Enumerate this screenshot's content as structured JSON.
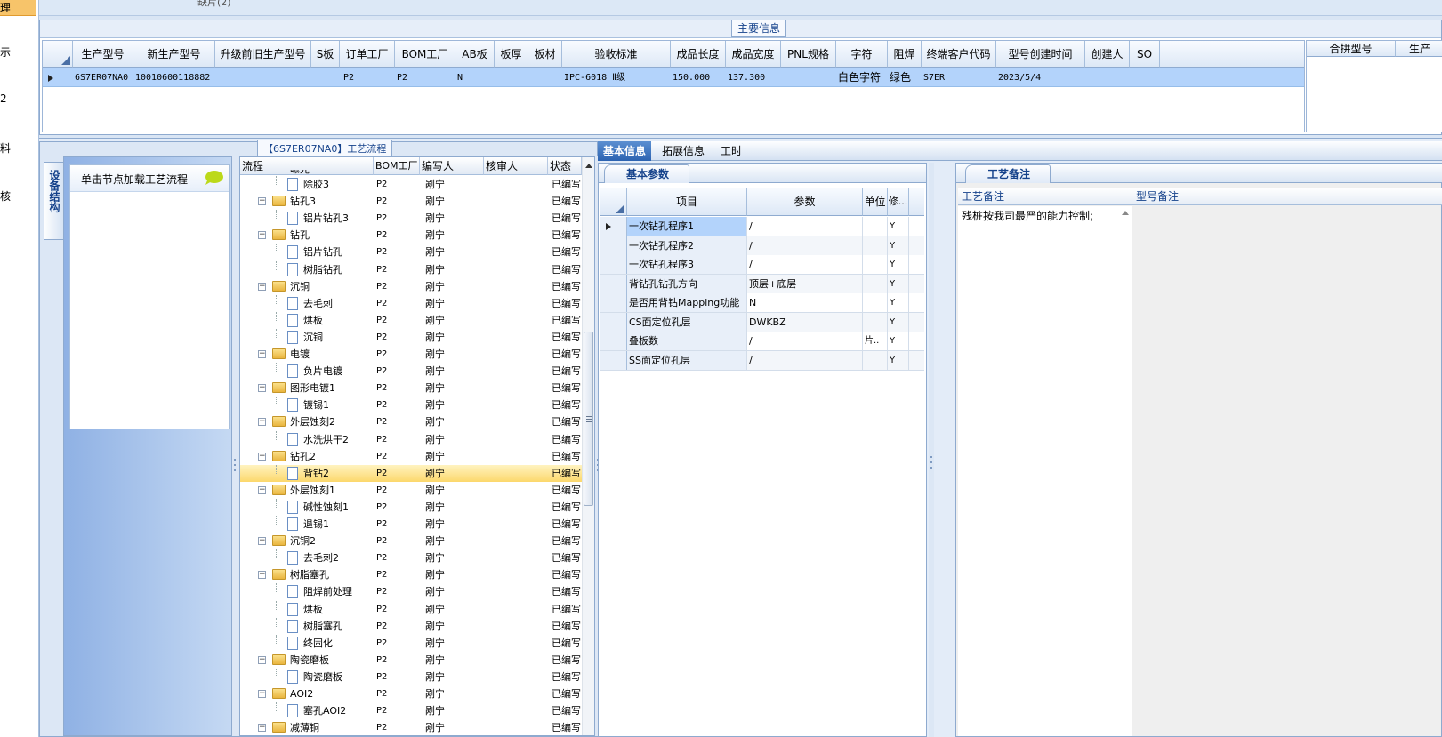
{
  "left_nav": {
    "items": [
      "理",
      "示",
      "2",
      "料",
      "核"
    ]
  },
  "top_fragment": "缺片(2)",
  "main_info": {
    "title": "主要信息",
    "columns": [
      "生产型号",
      "新生产型号",
      "升级前旧生产型号",
      "S板",
      "订单工厂",
      "BOM工厂",
      "AB板",
      "板厚",
      "板材",
      "验收标准",
      "成品长度",
      "成品宽度",
      "PNL规格",
      "字符",
      "阻焊",
      "终端客户代码",
      "型号创建时间",
      "创建人",
      "SO"
    ],
    "row": {
      "model": "6S7ER07NA0",
      "new_model": "10010600118882",
      "old_model": "",
      "s_board": "",
      "order_factory": "P2",
      "bom_factory": "P2",
      "ab_board": "N",
      "thickness": "",
      "material": "",
      "standard": "IPC-6018 Ⅱ级",
      "length": "150.000",
      "width": "137.300",
      "pnl": "",
      "char": "白色字符",
      "mask": "绿色",
      "customer_code": "S7ER",
      "created_time": "2023/5/4",
      "creator": "",
      "so": ""
    },
    "side_columns": [
      "合拼型号",
      "生产"
    ]
  },
  "process": {
    "title": "【6S7ER07NA0】工艺流程",
    "side_tab": "设备结构",
    "equip_hint": "单击节点加载工艺流程",
    "columns": [
      "流程",
      "BOM工厂",
      "编写人",
      "核审人",
      "状态"
    ],
    "partial_top_label": "曝光",
    "rows": [
      {
        "name": "除胶3",
        "level": 2,
        "bom": "P2",
        "writer": "剐宁",
        "status": "已编写"
      },
      {
        "name": "钻孔3",
        "level": 1,
        "bom": "P2",
        "writer": "剐宁",
        "status": "已编写"
      },
      {
        "name": "铝片钻孔3",
        "level": 2,
        "bom": "P2",
        "writer": "剐宁",
        "status": "已编写"
      },
      {
        "name": "钻孔",
        "level": 1,
        "bom": "P2",
        "writer": "剐宁",
        "status": "已编写"
      },
      {
        "name": "铝片钻孔",
        "level": 2,
        "bom": "P2",
        "writer": "剐宁",
        "status": "已编写"
      },
      {
        "name": "树脂钻孔",
        "level": 2,
        "bom": "P2",
        "writer": "剐宁",
        "status": "已编写"
      },
      {
        "name": "沉铜",
        "level": 1,
        "bom": "P2",
        "writer": "剐宁",
        "status": "已编写"
      },
      {
        "name": "去毛刺",
        "level": 2,
        "bom": "P2",
        "writer": "剐宁",
        "status": "已编写"
      },
      {
        "name": "烘板",
        "level": 2,
        "bom": "P2",
        "writer": "剐宁",
        "status": "已编写"
      },
      {
        "name": "沉铜",
        "level": 2,
        "bom": "P2",
        "writer": "剐宁",
        "status": "已编写"
      },
      {
        "name": "电镀",
        "level": 1,
        "bom": "P2",
        "writer": "剐宁",
        "status": "已编写"
      },
      {
        "name": "负片电镀",
        "level": 2,
        "bom": "P2",
        "writer": "剐宁",
        "status": "已编写"
      },
      {
        "name": "图形电镀1",
        "level": 1,
        "bom": "P2",
        "writer": "剐宁",
        "status": "已编写"
      },
      {
        "name": "镀锡1",
        "level": 2,
        "bom": "P2",
        "writer": "剐宁",
        "status": "已编写"
      },
      {
        "name": "外层蚀刻2",
        "level": 1,
        "bom": "P2",
        "writer": "剐宁",
        "status": "已编写"
      },
      {
        "name": "水洗烘干2",
        "level": 2,
        "bom": "P2",
        "writer": "剐宁",
        "status": "已编写"
      },
      {
        "name": "钻孔2",
        "level": 1,
        "bom": "P2",
        "writer": "剐宁",
        "status": "已编写"
      },
      {
        "name": "背钻2",
        "level": 2,
        "bom": "P2",
        "writer": "剐宁",
        "status": "已编写",
        "selected": true
      },
      {
        "name": "外层蚀刻1",
        "level": 1,
        "bom": "P2",
        "writer": "剐宁",
        "status": "已编写"
      },
      {
        "name": "碱性蚀刻1",
        "level": 2,
        "bom": "P2",
        "writer": "剐宁",
        "status": "已编写"
      },
      {
        "name": "退锡1",
        "level": 2,
        "bom": "P2",
        "writer": "剐宁",
        "status": "已编写"
      },
      {
        "name": "沉铜2",
        "level": 1,
        "bom": "P2",
        "writer": "剐宁",
        "status": "已编写"
      },
      {
        "name": "去毛刺2",
        "level": 2,
        "bom": "P2",
        "writer": "剐宁",
        "status": "已编写"
      },
      {
        "name": "树脂塞孔",
        "level": 1,
        "bom": "P2",
        "writer": "剐宁",
        "status": "已编写"
      },
      {
        "name": "阻焊前处理",
        "level": 2,
        "bom": "P2",
        "writer": "剐宁",
        "status": "已编写"
      },
      {
        "name": "烘板",
        "level": 2,
        "bom": "P2",
        "writer": "剐宁",
        "status": "已编写"
      },
      {
        "name": "树脂塞孔",
        "level": 2,
        "bom": "P2",
        "writer": "剐宁",
        "status": "已编写"
      },
      {
        "name": "终固化",
        "level": 2,
        "bom": "P2",
        "writer": "剐宁",
        "status": "已编写"
      },
      {
        "name": "陶瓷磨板",
        "level": 1,
        "bom": "P2",
        "writer": "剐宁",
        "status": "已编写"
      },
      {
        "name": "陶瓷磨板",
        "level": 2,
        "bom": "P2",
        "writer": "剐宁",
        "status": "已编写"
      },
      {
        "name": "AOI2",
        "level": 1,
        "bom": "P2",
        "writer": "剐宁",
        "status": "已编写"
      },
      {
        "name": "塞孔AOI2",
        "level": 2,
        "bom": "P2",
        "writer": "剐宁",
        "status": "已编写"
      },
      {
        "name": "减薄铜",
        "level": 1,
        "bom": "P2",
        "writer": "剐宁",
        "status": "已编写"
      }
    ]
  },
  "right_tabs": [
    "基本信息",
    "拓展信息",
    "工时"
  ],
  "base_params": {
    "tab": "基本参数",
    "columns": [
      "项目",
      "参数",
      "单位",
      "修..."
    ],
    "rows": [
      {
        "item": "一次钻孔程序1",
        "param": "/",
        "unit": "",
        "mod": "Y"
      },
      {
        "item": "一次钻孔程序2",
        "param": "/",
        "unit": "",
        "mod": "Y"
      },
      {
        "item": "一次钻孔程序3",
        "param": "/",
        "unit": "",
        "mod": "Y"
      },
      {
        "item": "背钻孔钻孔方向",
        "param": "顶层+底层",
        "unit": "",
        "mod": "Y"
      },
      {
        "item": "是否用背钻Mapping功能",
        "param": "N",
        "unit": "",
        "mod": "Y"
      },
      {
        "item": "CS面定位孔层",
        "param": "DWKBZ",
        "unit": "",
        "mod": "Y"
      },
      {
        "item": "叠板数",
        "param": "/",
        "unit": "片..",
        "mod": "Y"
      },
      {
        "item": "SS面定位孔层",
        "param": "/",
        "unit": "",
        "mod": "Y"
      }
    ]
  },
  "remarks": {
    "tab": "工艺备注",
    "process_header": "工艺备注",
    "model_header": "型号备注",
    "process_text": "残桩按我司最严的能力控制;"
  }
}
